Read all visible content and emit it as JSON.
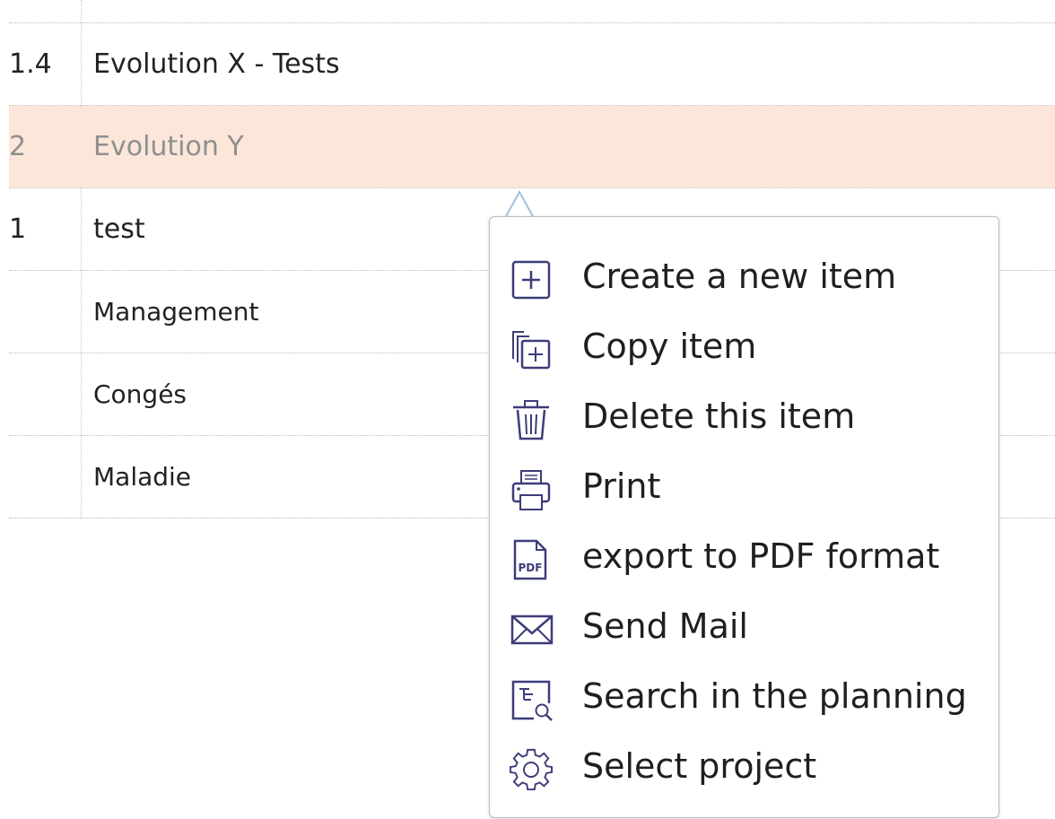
{
  "rows": [
    {
      "number": "1.4",
      "name": "Evolution X - Tests"
    },
    {
      "number": "2",
      "name": "Evolution Y"
    },
    {
      "number": "1",
      "name": "test"
    },
    {
      "number": "",
      "name": "Management"
    },
    {
      "number": "",
      "name": "Congés"
    },
    {
      "number": "",
      "name": "Maladie"
    }
  ],
  "selected_row_index": 1,
  "colors": {
    "selected_row_bg": "#fbe6d9",
    "icon_color": "#3d3d7a",
    "popup_border": "#b8bcc4",
    "arrow_color": "#9fc2e0"
  },
  "context_menu": {
    "items": [
      {
        "label": "Create a new item",
        "icon": "plus-box-icon"
      },
      {
        "label": "Copy item",
        "icon": "copy-icon"
      },
      {
        "label": "Delete this item",
        "icon": "trash-icon"
      },
      {
        "label": "Print",
        "icon": "printer-icon"
      },
      {
        "label": "export to PDF format",
        "icon": "pdf-icon"
      },
      {
        "label": "Send Mail",
        "icon": "mail-icon"
      },
      {
        "label": "Search in the planning",
        "icon": "planning-search-icon"
      },
      {
        "label": "Select project",
        "icon": "gear-icon"
      }
    ]
  }
}
